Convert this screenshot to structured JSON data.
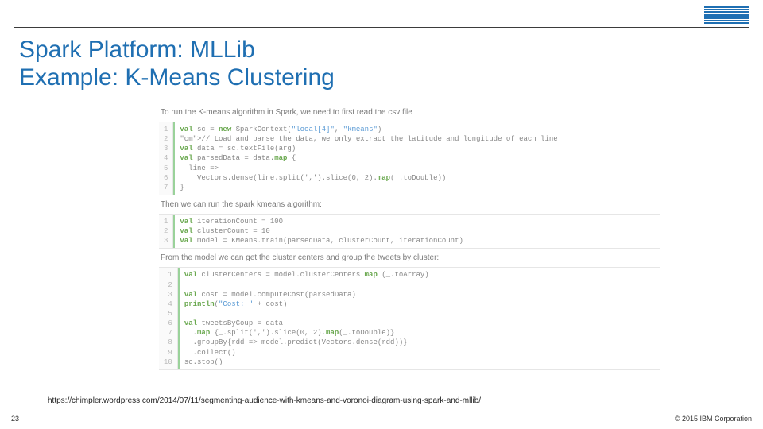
{
  "header": {
    "logo_name": "ibm-logo"
  },
  "title": {
    "line1": "Spark Platform: MLLib",
    "line2": "Example: K-Means Clustering"
  },
  "narration": {
    "n1": "To run the K-means algorithm in Spark, we need to first read the csv file",
    "n2": "Then we can run the spark kmeans algorithm:",
    "n3": "From the model we can get the cluster centers and group the tweets by cluster:"
  },
  "code": {
    "block1": {
      "line_numbers": "1\n2\n3\n4\n5\n6\n7",
      "raw": "val sc = new SparkContext(\"local[4]\", \"kmeans\")\n// Load and parse the data, we only extract the latitude and longitude of each line\nval data = sc.textFile(arg)\nval parsedData = data.map {\n  line =>\n    Vectors.dense(line.split(',').slice(0, 2).map(_.toDouble))\n}"
    },
    "block2": {
      "line_numbers": "1\n2\n3",
      "raw": "val iterationCount = 100\nval clusterCount = 10\nval model = KMeans.train(parsedData, clusterCount, iterationCount)"
    },
    "block3": {
      "line_numbers": "1\n2\n3\n4\n5\n6\n7\n8\n9\n10",
      "raw": "val clusterCenters = model.clusterCenters map (_.toArray)\n\nval cost = model.computeCost(parsedData)\nprintln(\"Cost: \" + cost)\n\nval tweetsByGoup = data\n  .map {_.split(',').slice(0, 2).map(_.toDouble)}\n  .groupBy{rdd => model.predict(Vectors.dense(rdd))}\n  .collect()\nsc.stop()"
    }
  },
  "footer": {
    "source_url": "https://chimpler.wordpress.com/2014/07/11/segmenting-audience-with-kmeans-and-voronoi-diagram-using-spark-and-mllib/",
    "page_number": "23",
    "copyright": "© 2015 IBM Corporation"
  }
}
